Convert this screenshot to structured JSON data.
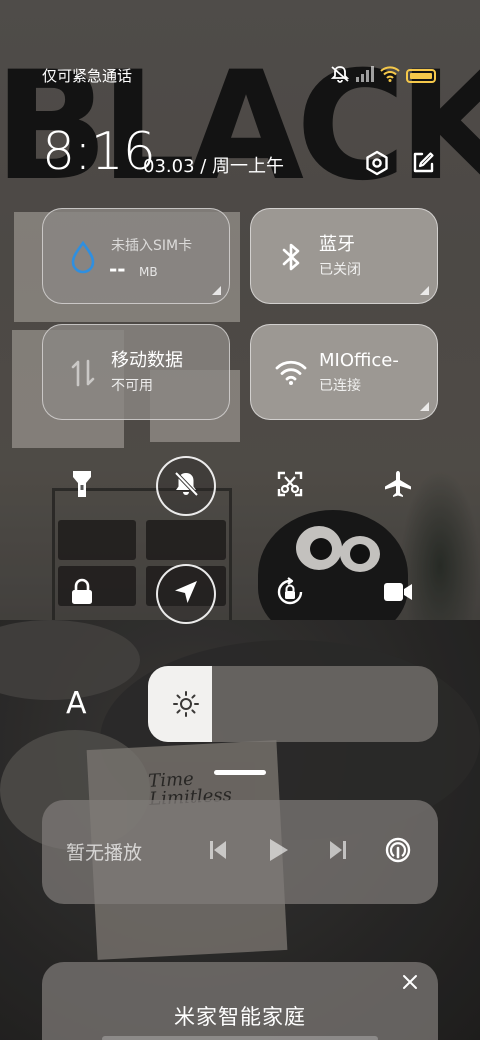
{
  "status_bar": {
    "carrier": "仅可紧急通话",
    "icons": [
      "mute-icon",
      "signal-icon",
      "wifi-icon",
      "battery-icon"
    ]
  },
  "header": {
    "time": "8:16",
    "date": "03.03 / 周一上午",
    "icons": [
      "settings-icon",
      "edit-icon"
    ]
  },
  "wallpaper": {
    "headline": "BLACK",
    "magazine_title": "Time Limitless"
  },
  "tiles": {
    "data_usage": {
      "label": "未插入SIM卡",
      "value": "--",
      "unit": "MB",
      "icon": "water-drop-icon"
    },
    "bluetooth": {
      "label": "蓝牙",
      "status": "已关闭",
      "icon": "bluetooth-icon"
    },
    "mobile_data": {
      "label": "移动数据",
      "status": "不可用",
      "icon": "data-arrows-icon"
    },
    "wifi": {
      "label": "MIOffice-",
      "status": "已连接",
      "icon": "wifi-icon"
    }
  },
  "toggles": [
    {
      "name": "flashlight",
      "icon": "flashlight-icon",
      "on": false
    },
    {
      "name": "mute",
      "icon": "bell-off-icon",
      "on": true
    },
    {
      "name": "screenshot",
      "icon": "scissors-icon",
      "on": false
    },
    {
      "name": "airplane",
      "icon": "airplane-icon",
      "on": false
    },
    {
      "name": "lock",
      "icon": "lock-icon",
      "on": false
    },
    {
      "name": "location",
      "icon": "location-arrow-icon",
      "on": true
    },
    {
      "name": "rotation-lock",
      "icon": "rotation-lock-icon",
      "on": false
    },
    {
      "name": "screen-record",
      "icon": "video-camera-icon",
      "on": false
    }
  ],
  "brightness": {
    "auto_label": "A",
    "level": 0.22,
    "icon": "sun-icon"
  },
  "media": {
    "label": "暂无播放",
    "icons": [
      "previous-icon",
      "play-icon",
      "next-icon",
      "cast-icon"
    ]
  },
  "smart_home": {
    "title": "米家智能家庭",
    "icon": "close-icon"
  },
  "colors": {
    "battery": "#f5c84a",
    "tile_bg": "#8a8682",
    "accent_blue": "#2f8fe0"
  }
}
